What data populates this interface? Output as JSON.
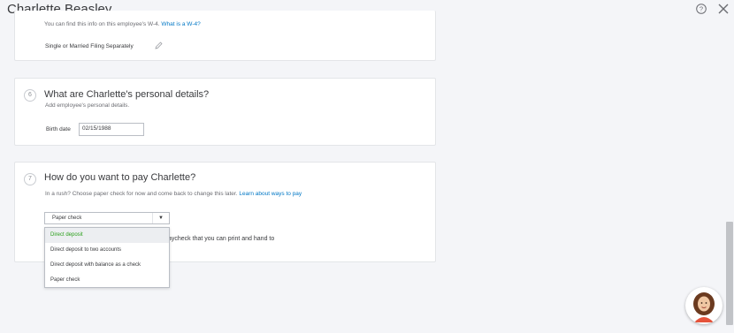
{
  "header": {
    "title": "Charlette Beasley",
    "help_icon": "help-circle-icon",
    "close_icon": "close-icon"
  },
  "w4_section": {
    "info_text": "You can find this info on this employee's W-4.",
    "info_link": "What is a W-4?",
    "filing_status": "Single or Married Filing Separately",
    "edit_icon": "pencil-icon"
  },
  "personal_section": {
    "step": "6",
    "title": "What are Charlette's personal details?",
    "subtitle": "Add employee's personal details.",
    "birth_date_label": "Birth date",
    "birth_date_value": "02/15/1988"
  },
  "pay_section": {
    "step": "7",
    "title": "How do you want to pay Charlette?",
    "subtitle": "In a rush? Choose paper check for now and come back to change this later.",
    "subtitle_link": "Learn about ways to pay",
    "selected_method": "Paper check",
    "behind_text": "aycheck that you can print and hand to",
    "options": [
      "Direct deposit",
      "Direct deposit to two accounts",
      "Direct deposit with balance as a check",
      "Paper check"
    ]
  },
  "colors": {
    "accent_green": "#2ca01c",
    "link_blue": "#0077c5"
  }
}
